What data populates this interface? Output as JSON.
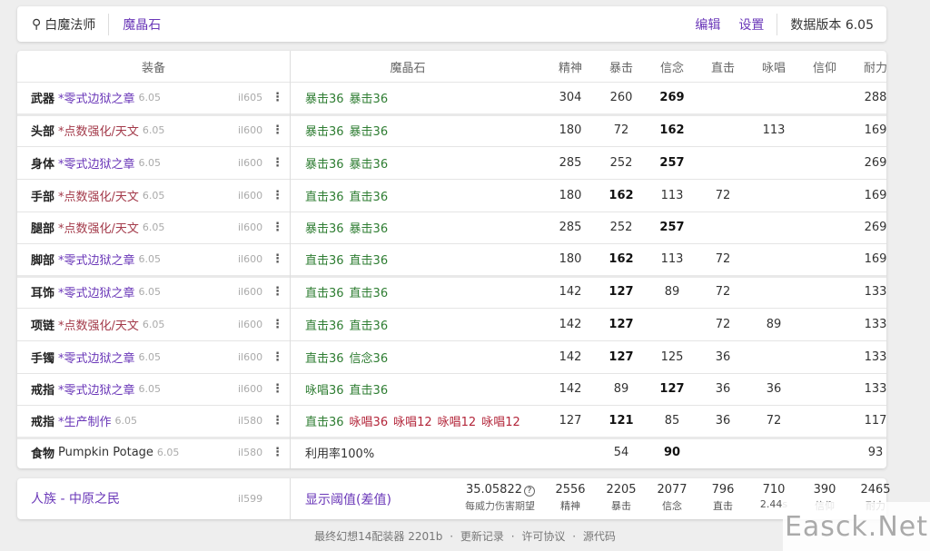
{
  "header": {
    "job": "白魔法师",
    "tab_materia": "魔晶石",
    "edit": "编辑",
    "settings": "设置",
    "version": "数据版本 6.05"
  },
  "table": {
    "headers": {
      "gear": "装备",
      "materia": "魔晶石",
      "stats": [
        "精神",
        "暴击",
        "信念",
        "直击",
        "咏唱",
        "信仰",
        "耐力"
      ]
    },
    "rows": [
      {
        "slot": "武器",
        "name": "*零式边狱之章",
        "color": "purple",
        "ver": "6.05",
        "ilvl": "il605",
        "materia": [
          {
            "t": "暴击36",
            "c": "green"
          },
          {
            "t": "暴击36",
            "c": "green"
          }
        ],
        "stats": [
          "304",
          "260",
          "269",
          "",
          "",
          "",
          "288"
        ],
        "bold": [
          2
        ]
      },
      {
        "slot": "头部",
        "name": "*点数强化/天文",
        "color": "red",
        "ver": "6.05",
        "ilvl": "il600",
        "materia": [
          {
            "t": "暴击36",
            "c": "green"
          },
          {
            "t": "暴击36",
            "c": "green"
          }
        ],
        "stats": [
          "180",
          "72",
          "162",
          "",
          "113",
          "",
          "169"
        ],
        "bold": [
          2
        ]
      },
      {
        "slot": "身体",
        "name": "*零式边狱之章",
        "color": "purple",
        "ver": "6.05",
        "ilvl": "il600",
        "materia": [
          {
            "t": "暴击36",
            "c": "green"
          },
          {
            "t": "暴击36",
            "c": "green"
          }
        ],
        "stats": [
          "285",
          "252",
          "257",
          "",
          "",
          "",
          "269"
        ],
        "bold": [
          2
        ]
      },
      {
        "slot": "手部",
        "name": "*点数强化/天文",
        "color": "red",
        "ver": "6.05",
        "ilvl": "il600",
        "materia": [
          {
            "t": "直击36",
            "c": "green"
          },
          {
            "t": "直击36",
            "c": "green"
          }
        ],
        "stats": [
          "180",
          "162",
          "113",
          "72",
          "",
          "",
          "169"
        ],
        "bold": [
          1
        ]
      },
      {
        "slot": "腿部",
        "name": "*点数强化/天文",
        "color": "red",
        "ver": "6.05",
        "ilvl": "il600",
        "materia": [
          {
            "t": "暴击36",
            "c": "green"
          },
          {
            "t": "暴击36",
            "c": "green"
          }
        ],
        "stats": [
          "285",
          "252",
          "257",
          "",
          "",
          "",
          "269"
        ],
        "bold": [
          2
        ]
      },
      {
        "slot": "脚部",
        "name": "*零式边狱之章",
        "color": "purple",
        "ver": "6.05",
        "ilvl": "il600",
        "materia": [
          {
            "t": "直击36",
            "c": "green"
          },
          {
            "t": "直击36",
            "c": "green"
          }
        ],
        "stats": [
          "180",
          "162",
          "113",
          "72",
          "",
          "",
          "169"
        ],
        "bold": [
          1
        ]
      },
      {
        "slot": "耳饰",
        "name": "*零式边狱之章",
        "color": "purple",
        "ver": "6.05",
        "ilvl": "il600",
        "materia": [
          {
            "t": "直击36",
            "c": "green"
          },
          {
            "t": "直击36",
            "c": "green"
          }
        ],
        "stats": [
          "142",
          "127",
          "89",
          "72",
          "",
          "",
          "133"
        ],
        "bold": [
          1
        ]
      },
      {
        "slot": "项链",
        "name": "*点数强化/天文",
        "color": "red",
        "ver": "6.05",
        "ilvl": "il600",
        "materia": [
          {
            "t": "直击36",
            "c": "green"
          },
          {
            "t": "直击36",
            "c": "green"
          }
        ],
        "stats": [
          "142",
          "127",
          "",
          "72",
          "89",
          "",
          "133"
        ],
        "bold": [
          1
        ]
      },
      {
        "slot": "手镯",
        "name": "*零式边狱之章",
        "color": "purple",
        "ver": "6.05",
        "ilvl": "il600",
        "materia": [
          {
            "t": "直击36",
            "c": "green"
          },
          {
            "t": "信念36",
            "c": "green"
          }
        ],
        "stats": [
          "142",
          "127",
          "125",
          "36",
          "",
          "",
          "133"
        ],
        "bold": [
          1
        ]
      },
      {
        "slot": "戒指",
        "name": "*零式边狱之章",
        "color": "purple",
        "ver": "6.05",
        "ilvl": "il600",
        "materia": [
          {
            "t": "咏唱36",
            "c": "green"
          },
          {
            "t": "直击36",
            "c": "green"
          }
        ],
        "stats": [
          "142",
          "89",
          "127",
          "36",
          "36",
          "",
          "133"
        ],
        "bold": [
          2
        ]
      },
      {
        "slot": "戒指",
        "name": "*生产制作",
        "color": "purple",
        "ver": "6.05",
        "ilvl": "il580",
        "materia": [
          {
            "t": "直击36",
            "c": "green"
          },
          {
            "t": "咏唱36",
            "c": "red"
          },
          {
            "t": "咏唱12",
            "c": "red"
          },
          {
            "t": "咏唱12",
            "c": "red"
          },
          {
            "t": "咏唱12",
            "c": "red"
          }
        ],
        "stats": [
          "127",
          "121",
          "85",
          "36",
          "72",
          "",
          "117"
        ],
        "bold": [
          1
        ]
      },
      {
        "slot": "食物",
        "name": "Pumpkin Potage",
        "color": "plain",
        "ver": "6.05",
        "ilvl": "il580",
        "materia": [
          {
            "t": "利用率100%",
            "c": "plain"
          }
        ],
        "stats": [
          "",
          "54",
          "90",
          "",
          "",
          "",
          "93"
        ],
        "bold": [
          2
        ]
      }
    ]
  },
  "summary": {
    "race": "人族 - 中原之民",
    "ilvl": "il599",
    "threshold": "显示阈值(差值)",
    "damage_value": "35.05822",
    "damage_label": "每威力伤害期望",
    "stats": [
      {
        "v": "2556",
        "l": "精神"
      },
      {
        "v": "2205",
        "l": "暴击"
      },
      {
        "v": "2077",
        "l": "信念"
      },
      {
        "v": "796",
        "l": "直击"
      },
      {
        "v": "710",
        "l": "2.44s"
      },
      {
        "v": "390",
        "l": "信仰"
      },
      {
        "v": "2465",
        "l": "耐力"
      }
    ]
  },
  "footer": {
    "app": "最终幻想14配装器 2201b",
    "changelog": "更新记录",
    "license": "许可协议",
    "source": "源代码"
  },
  "watermark": "Easck.Net",
  "colors": {
    "accent": "#6a37b8",
    "materia_green": "#2e7d32",
    "materia_red": "#b3263a",
    "gear_red": "#a33a4a"
  }
}
